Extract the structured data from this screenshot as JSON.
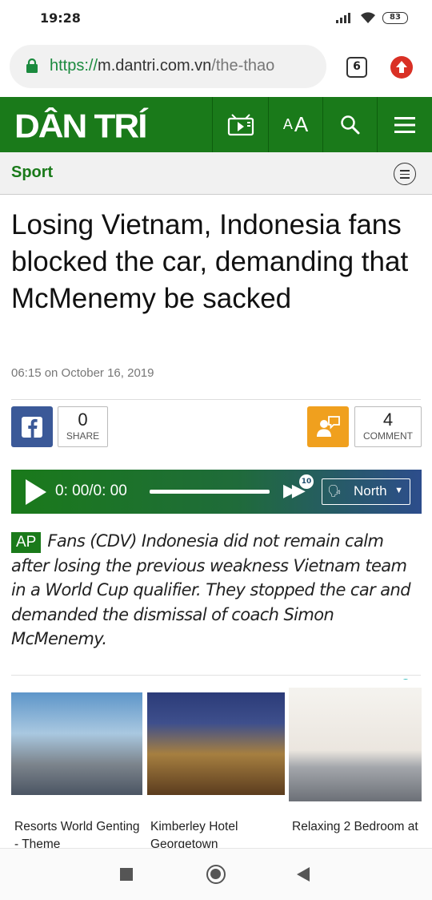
{
  "status": {
    "time": "19:28",
    "battery": "83"
  },
  "browser": {
    "url_scheme": "https://",
    "url_host": "m.dantri.com.vn",
    "url_path": "/the-thao",
    "tab_count": "6"
  },
  "site": {
    "logo": "DÂN TRÍ",
    "font_toggle_small": "A",
    "font_toggle_large": "A",
    "brand_color": "#1a7a1a"
  },
  "section": {
    "title": "Sport"
  },
  "article": {
    "headline": "Losing Vietnam, Indonesia fans blocked the car, demanding that McMenemy be sacked",
    "dateline": "06:15 on October 16, 2019",
    "share_count": "0",
    "share_label": "SHARE",
    "comment_count": "4",
    "comment_label": "COMMENT",
    "lead_badge": "AP",
    "lead": "Fans (CDV) Indonesia did not remain calm after losing the previous weakness Vietnam team in a World Cup qualifier. They stopped the car and demanded the dismissal of coach Simon McMenemy."
  },
  "player": {
    "time": "0: 00/0: 00",
    "skip_seconds": "10",
    "voice": "North"
  },
  "ads": [
    {
      "title": "Resorts World Genting - Theme"
    },
    {
      "title": "Kimberley Hotel Georgetown"
    },
    {
      "title": "Relaxing 2 Bedroom at"
    }
  ]
}
